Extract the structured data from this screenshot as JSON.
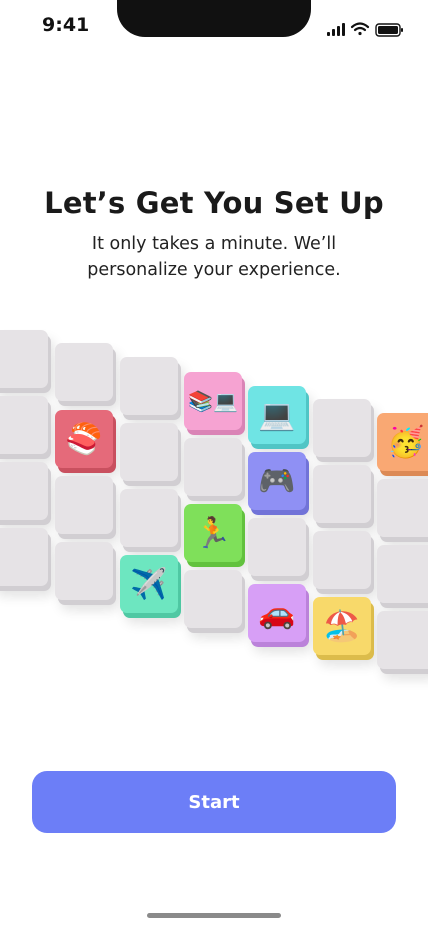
{
  "status_bar": {
    "time": "9:41",
    "icons": [
      "cellular-signal-icon",
      "wifi-icon",
      "battery-icon"
    ]
  },
  "header": {
    "title": "Let’s Get You Set Up",
    "subtitle_line1": "It only takes a minute. We’ll",
    "subtitle_line2": "personalize your experience."
  },
  "tiles": [
    {
      "name": "sushi",
      "emoji": "🍣",
      "color": "#e56a7a"
    },
    {
      "name": "books-laptop",
      "emoji": "📚💻",
      "color": "#f6a3d2"
    },
    {
      "name": "laptop",
      "emoji": "💻",
      "color": "#6fe4e4"
    },
    {
      "name": "party",
      "emoji": "🥳",
      "color": "#f9a873"
    },
    {
      "name": "game-controller",
      "emoji": "🎮",
      "color": "#8f90f4"
    },
    {
      "name": "running",
      "emoji": "🏃",
      "color": "#7fe05a"
    },
    {
      "name": "airplane",
      "emoji": "✈️",
      "color": "#6de6c0"
    },
    {
      "name": "car",
      "emoji": "🚗",
      "color": "#d79ff6"
    },
    {
      "name": "beach",
      "emoji": "🏖️",
      "color": "#f8d96a"
    }
  ],
  "actions": {
    "start_label": "Start"
  }
}
